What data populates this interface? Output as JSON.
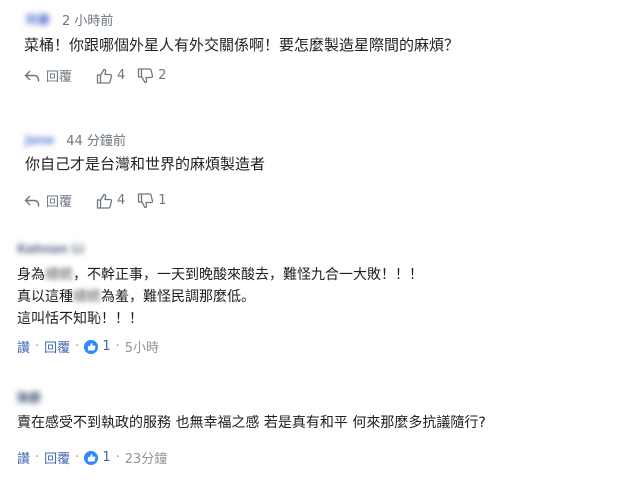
{
  "comments": [
    {
      "user": "阿豪",
      "time": "2 小時前",
      "text": "菜桶！你跟哪個外星人有外交關係啊！要怎麼製造星際間的麻煩？",
      "reply_label": "回覆",
      "likes": "4",
      "dislikes": "2"
    },
    {
      "user": "Jane",
      "time": "44 分鐘前",
      "text": "你自己才是台灣和世界的麻煩製造者",
      "reply_label": "回覆",
      "likes": "4",
      "dislikes": "1"
    }
  ],
  "fb_comments": [
    {
      "user": "Kahnan Li",
      "lines": {
        "l1_a": "身為",
        "l1_blur": "總統",
        "l1_b": "，不幹正事，一天到晚酸來酸去，難怪九合一大敗！！！",
        "l2_a": "真以這種",
        "l2_blur": "總統",
        "l2_b": "為羞，難怪民調那麼低。",
        "l3": "這叫恬不知恥！！！"
      },
      "like_label": "讚",
      "reply_label": "回覆",
      "reactions": "1",
      "time": "5小時"
    },
    {
      "user": "陳爵",
      "text": "賣在感受不到執政的服務 也無幸福之感 若是真有和平 何來那麼多抗議隨行?",
      "like_label": "讚",
      "reply_label": "回覆",
      "reactions": "1",
      "time": "23分鐘"
    }
  ],
  "separator": "·",
  "icons": {
    "reply": "reply-arrow-icon",
    "thumb_up": "thumbs-up-icon",
    "thumb_down": "thumbs-down-icon",
    "like_badge": "like-badge-icon"
  },
  "colors": {
    "link_blue": "#4267b2",
    "muted_gray": "#6e7780",
    "badge_blue": "#2d88ff"
  }
}
